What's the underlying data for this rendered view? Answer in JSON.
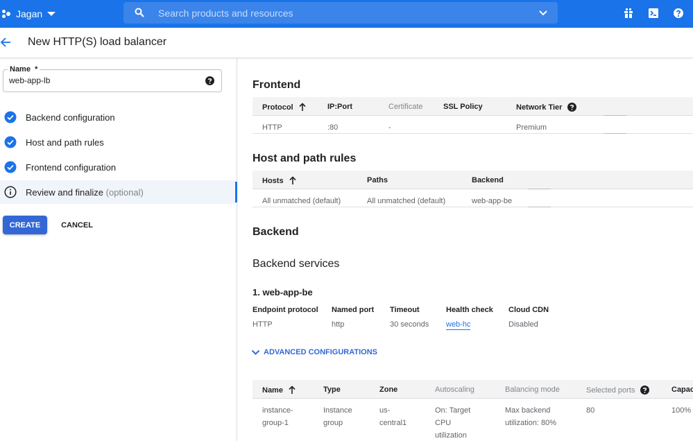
{
  "topbar": {
    "project": "Jagan",
    "search_placeholder": "Search products and resources",
    "icons": [
      "gift-icon",
      "cloud-shell-icon",
      "help-icon"
    ],
    "brand_color": "#1a73e8"
  },
  "header": {
    "title": "New HTTP(S) load balancer"
  },
  "left": {
    "name_label": "Name",
    "name_required": "*",
    "name_value": "web-app-lb",
    "steps": [
      {
        "label": "Backend configuration",
        "status": "complete"
      },
      {
        "label": "Host and path rules",
        "status": "complete"
      },
      {
        "label": "Frontend configuration",
        "status": "complete"
      },
      {
        "label": "Review and finalize",
        "suffix": "(optional)",
        "status": "active"
      }
    ],
    "create_label": "CREATE",
    "cancel_label": "CANCEL"
  },
  "frontend": {
    "heading": "Frontend",
    "columns": [
      "Protocol",
      "IP:Port",
      "Certificate",
      "SSL Policy",
      "Network Tier"
    ],
    "rows": [
      [
        "HTTP",
        ":80",
        "-",
        "",
        "Premium"
      ]
    ]
  },
  "host_path": {
    "heading": "Host and path rules",
    "columns": [
      "Hosts",
      "Paths",
      "Backend"
    ],
    "rows": [
      [
        "All unmatched (default)",
        "All unmatched (default)",
        "web-app-be"
      ]
    ]
  },
  "backend": {
    "heading": "Backend",
    "services_heading": "Backend services",
    "service_title": "1. web-app-be",
    "fields": [
      {
        "label": "Endpoint protocol",
        "value": "HTTP"
      },
      {
        "label": "Named port",
        "value": "http"
      },
      {
        "label": "Timeout",
        "value": "30 seconds"
      },
      {
        "label": "Health check",
        "value": "web-hc"
      },
      {
        "label": "Cloud CDN",
        "value": "Disabled"
      }
    ],
    "advanced_label": "ADVANCED CONFIGURATIONS",
    "columns": [
      "Name",
      "Type",
      "Zone",
      "Autoscaling",
      "Balancing mode",
      "Selected ports",
      "Capac"
    ],
    "rows": [
      [
        "instance-group-1",
        "Instance group",
        "us-central1",
        "On: Target CPU utilization",
        "Max backend utilization: 80%",
        "80",
        "100%"
      ]
    ]
  }
}
